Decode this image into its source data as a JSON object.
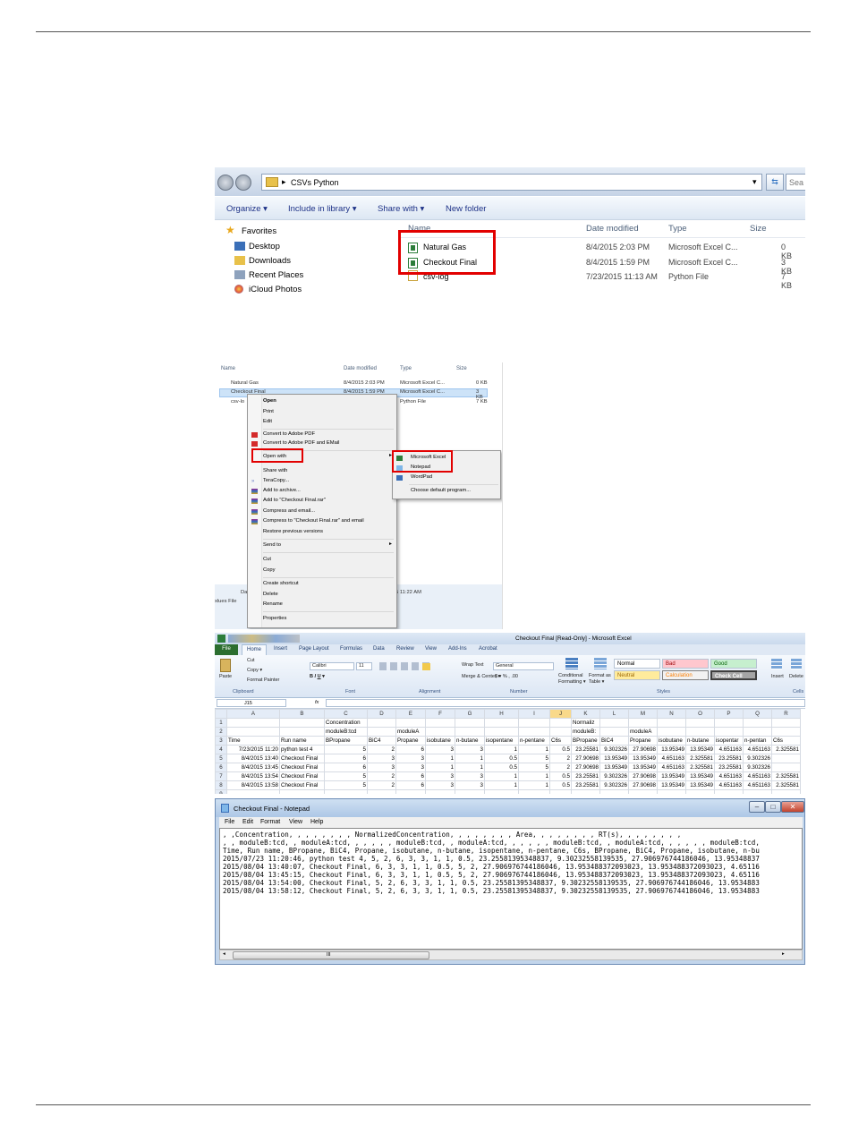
{
  "explorer": {
    "path": "CSVs Python",
    "search_placeholder": "Sea",
    "toolbar": [
      "Organize ▾",
      "Include in library ▾",
      "Share with ▾",
      "New folder"
    ],
    "nav": [
      "Favorites",
      "Desktop",
      "Downloads",
      "Recent Places",
      "iCloud Photos"
    ],
    "columns": [
      "Name",
      "Date modified",
      "Type",
      "Size"
    ],
    "files": [
      {
        "name": "Natural Gas",
        "date": "8/4/2015 2:03 PM",
        "type": "Microsoft Excel C...",
        "size": "0 KB"
      },
      {
        "name": "Checkout Final",
        "date": "8/4/2015 1:59 PM",
        "type": "Microsoft Excel C...",
        "size": "3 KB"
      },
      {
        "name": "csv-log",
        "date": "7/23/2015 11:13 AM",
        "type": "Python File",
        "size": "7 KB"
      }
    ]
  },
  "context": {
    "columns": [
      "Name",
      "Date modified",
      "Type",
      "Size"
    ],
    "files": [
      {
        "name": "Natural Gas",
        "date": "8/4/2015 2:03 PM",
        "type": "Microsoft Excel C...",
        "size": "0 KB"
      },
      {
        "name": "Checkout Final",
        "date": "8/4/2015 1:59 PM",
        "type": "Microsoft Excel C...",
        "size": "3 KB"
      },
      {
        "name": "csv-lo",
        "date": "",
        "type": "Python File",
        "size": "7 KB"
      }
    ],
    "menu": [
      "Open",
      "Print",
      "Edit",
      "Convert to Adobe PDF",
      "Convert to Adobe PDF and EMail",
      "Open with",
      "Share with",
      "TeraCopy...",
      "Add to archive...",
      "Add to \"Checkout Final.rar\"",
      "Compress and email...",
      "Compress to \"Checkout Final.rar\" and email",
      "Restore previous versions",
      "Send to",
      "Cut",
      "Copy",
      "Create shortcut",
      "Delete",
      "Rename",
      "Properties"
    ],
    "submenu": [
      "Microsoft Excel",
      "Notepad",
      "WordPad",
      "Choose default program..."
    ],
    "bottom_left": "Da",
    "bottom_left2": "xlues File",
    "bottom_time": "5 11:22 AM"
  },
  "excel": {
    "title": "Checkout Final [Read-Only] - Microsoft Excel",
    "tabs": [
      "File",
      "Home",
      "Insert",
      "Page Layout",
      "Formulas",
      "Data",
      "Review",
      "View",
      "Add-Ins",
      "Acrobat"
    ],
    "ribbon": {
      "cut": "Cut",
      "copy": "Copy ▾",
      "format_painter": "Format Painter",
      "paste": "Paste",
      "font": "Calibri",
      "size": "11",
      "wrap": "Wrap Text",
      "merge": "Merge & Center ▾",
      "number_format": "General",
      "conditional": "Conditional Formatting ▾",
      "format_table": "Format as Table ▾",
      "styles": [
        "Normal",
        "Bad",
        "Good",
        "Neutral",
        "Calculation",
        "Check Cell"
      ],
      "insert": "Insert",
      "delete": "Delete",
      "groups": [
        "Clipboard",
        "Font",
        "Alignment",
        "Number",
        "Styles",
        "Cells"
      ]
    },
    "namebox": "J15",
    "fx": "fx",
    "col_headers": [
      "A",
      "B",
      "C",
      "D",
      "E",
      "F",
      "G",
      "H",
      "I",
      "J",
      "K",
      "L",
      "M",
      "N",
      "O",
      "P",
      "Q",
      "R"
    ],
    "rows": [
      [
        "",
        "",
        "Concentration",
        "",
        "",
        "",
        "",
        "",
        "",
        "",
        "Normaliz",
        "",
        "",
        "",
        "",
        "",
        "",
        ""
      ],
      [
        "",
        "",
        "moduleB:tcd",
        "",
        "moduleA",
        "",
        "",
        "",
        "",
        "",
        "moduleB:",
        "",
        "moduleA",
        "",
        "",
        "",
        "",
        ""
      ],
      [
        "Time",
        "Run name",
        "BPropane",
        "BiC4",
        "Propane",
        "isobutane",
        "n-butane",
        "isopentane",
        "n-pentane",
        "C6s",
        "BPropane",
        "BiC4",
        "Propane",
        "isobutane",
        "n-butane",
        "isopentar",
        "n-pentan",
        "C6s"
      ],
      [
        "7/23/2015 11:20",
        "python test 4",
        "5",
        "2",
        "6",
        "3",
        "3",
        "1",
        "1",
        "0.5",
        "23.25581",
        "9.302326",
        "27.90698",
        "13.95349",
        "13.95349",
        "4.651163",
        "4.651163",
        "2.325581"
      ],
      [
        "8/4/2015 13:40",
        "Checkout Final",
        "6",
        "3",
        "3",
        "1",
        "1",
        "0.5",
        "5",
        "2",
        "27.90698",
        "13.95349",
        "13.95349",
        "4.651163",
        "2.325581",
        "23.25581",
        "9.302326",
        ""
      ],
      [
        "8/4/2015 13:45",
        "Checkout Final",
        "6",
        "3",
        "3",
        "1",
        "1",
        "0.5",
        "5",
        "2",
        "27.90698",
        "13.95349",
        "13.95349",
        "4.651163",
        "2.325581",
        "23.25581",
        "9.302326",
        ""
      ],
      [
        "8/4/2015 13:54",
        "Checkout Final",
        "5",
        "2",
        "6",
        "3",
        "3",
        "1",
        "1",
        "0.5",
        "23.25581",
        "9.302326",
        "27.90698",
        "13.95349",
        "13.95349",
        "4.651163",
        "4.651163",
        "2.325581"
      ],
      [
        "8/4/2015 13:58",
        "Checkout Final",
        "5",
        "2",
        "6",
        "3",
        "3",
        "1",
        "1",
        "0.5",
        "23.25581",
        "9.302326",
        "27.90698",
        "13.95349",
        "13.95349",
        "4.651163",
        "4.651163",
        "2.325581"
      ]
    ]
  },
  "notepad": {
    "title": "Checkout Final - Notepad",
    "menu": [
      "File",
      "Edit",
      "Format",
      "View",
      "Help"
    ],
    "lines": [
      ", ,Concentration, , , , , , , , NormalizedConcentration, , , , , , , , Area, , , , , , , , RT(s), , , , , , , ,",
      ", , moduleB:tcd, , moduleA:tcd, , , , , , moduleB:tcd, , moduleA:tcd, , , , , , moduleB:tcd, , moduleA:tcd, , , , , , moduleB:tcd,",
      "Time, Run name, BPropane, BiC4, Propane, isobutane, n-butane, isopentane, n-pentane, C6s, BPropane, BiC4, Propane, isobutane, n-bu",
      "2015/07/23 11:20:46, python test 4, 5, 2, 6, 3, 3, 1, 1, 0.5, 23.25581395348837, 9.30232558139535, 27.906976744186046, 13.95348837",
      "2015/08/04 13:40:07, Checkout Final, 6, 3, 3, 1, 1, 0.5, 5, 2, 27.906976744186046, 13.953488372093023, 13.953488372093023, 4.65116",
      "2015/08/04 13:45:15, Checkout Final, 6, 3, 3, 1, 1, 0.5, 5, 2, 27.906976744186046, 13.953488372093023, 13.953488372093023, 4.65116",
      "2015/08/04 13:54:00, Checkout Final, 5, 2, 6, 3, 3, 1, 1, 0.5, 23.25581395348837, 9.30232558139535, 27.906976744186046, 13.9534883",
      "2015/08/04 13:58:12, Checkout Final, 5, 2, 6, 3, 3, 1, 1, 0.5, 23.25581395348837, 9.30232558139535, 27.906976744186046, 13.9534883"
    ],
    "scroll_thumb": "III"
  }
}
